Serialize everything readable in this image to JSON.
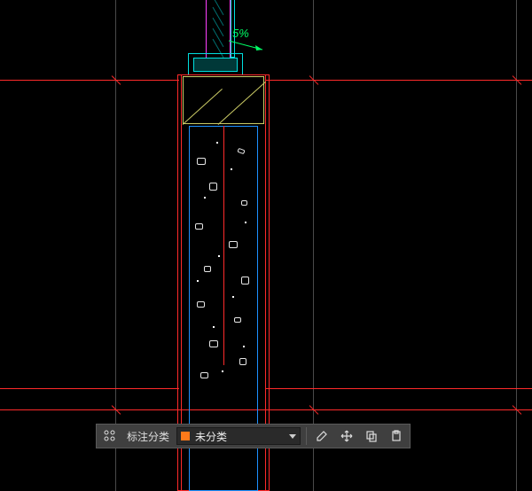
{
  "toolbar": {
    "label": "标注分类",
    "selected": "未分类",
    "swatch_color": "#ff7a1a",
    "icons": {
      "grid": "grid-icon",
      "edit": "edit-icon",
      "move": "move-icon",
      "copy": "copy-icon",
      "paste": "paste-icon"
    }
  },
  "annotation": {
    "slope_text": "5%"
  },
  "colors": {
    "red": "#ff2a2a",
    "blue": "#1e90ff",
    "yellow": "#cccc66",
    "cyan": "#00e0e0",
    "magenta": "#ff40ff",
    "green": "#00ff66"
  }
}
